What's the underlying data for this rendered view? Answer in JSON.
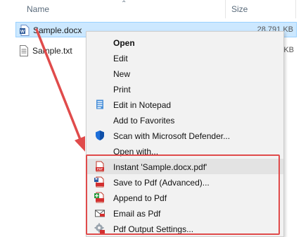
{
  "header": {
    "name_label": "Name",
    "size_label": "Size"
  },
  "files": [
    {
      "name": "Sample.docx",
      "size": "28,791 KB",
      "icon": "word-doc-icon"
    },
    {
      "name": "Sample.txt",
      "size": "5 KB",
      "icon": "text-file-icon"
    }
  ],
  "menu": {
    "items": [
      {
        "label": "Open",
        "bold": true
      },
      {
        "label": "Edit"
      },
      {
        "label": "New"
      },
      {
        "label": "Print"
      },
      {
        "label": "Edit in Notepad",
        "icon": "notepad-icon"
      },
      {
        "label": "Add to Favorites"
      },
      {
        "label": "Scan with Microsoft Defender...",
        "icon": "defender-shield-icon"
      },
      {
        "label": "Open with..."
      },
      {
        "label": "Instant 'Sample.docx.pdf'",
        "icon": "pdf-instant-icon"
      },
      {
        "label": "Save to Pdf (Advanced)...",
        "icon": "pdf-save-icon"
      },
      {
        "label": "Append to Pdf",
        "icon": "pdf-append-icon"
      },
      {
        "label": "Email as Pdf",
        "icon": "pdf-email-icon"
      },
      {
        "label": "Pdf Output Settings...",
        "icon": "pdf-settings-icon"
      }
    ]
  },
  "colors": {
    "highlight": "#e04b4b",
    "selection": "#cce8ff",
    "menu_bg": "#f2f2f2"
  }
}
